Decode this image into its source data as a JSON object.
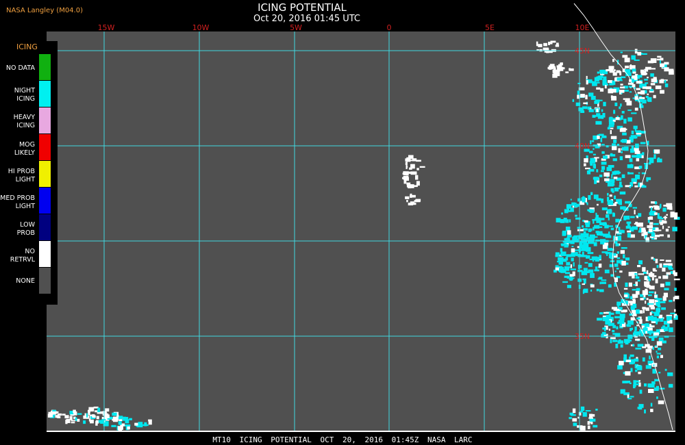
{
  "header": {
    "credit": "NASA Langley (M04.0)",
    "title": "ICING POTENTIAL",
    "subtitle": "Oct 20, 2016 01:45 UTC"
  },
  "map": {
    "background": "#505050",
    "grid_color": "#40d8e0",
    "label_color": "#d02020",
    "coast_color": "#ffffff",
    "longitude_labels": [
      "15W",
      "10W",
      "5W",
      "0",
      "5E",
      "10E"
    ],
    "latitude_labels": [
      "45N",
      "40N",
      "35N"
    ]
  },
  "legend": {
    "title": "ICING",
    "items": [
      {
        "label": "NO DATA",
        "color": "#10b010"
      },
      {
        "label": "NIGHT\nICING",
        "color": "#00f0f0"
      },
      {
        "label": "HEAVY\nICING",
        "color": "#e8a8e0"
      },
      {
        "label": "MOG\nLIKELY",
        "color": "#f00000"
      },
      {
        "label": "HI PROB\nLIGHT",
        "color": "#f0f000"
      },
      {
        "label": "MED PROB\nLIGHT",
        "color": "#0000f0"
      },
      {
        "label": "LOW\nPROB",
        "color": "#000080"
      },
      {
        "label": "NO\nRETRVL",
        "color": "#ffffff"
      },
      {
        "label": "NONE",
        "color": "#505050"
      }
    ]
  },
  "footer": {
    "text": "MT10 ICING POTENTIAL OCT 20, 2016 01:45Z NASA LARC"
  }
}
